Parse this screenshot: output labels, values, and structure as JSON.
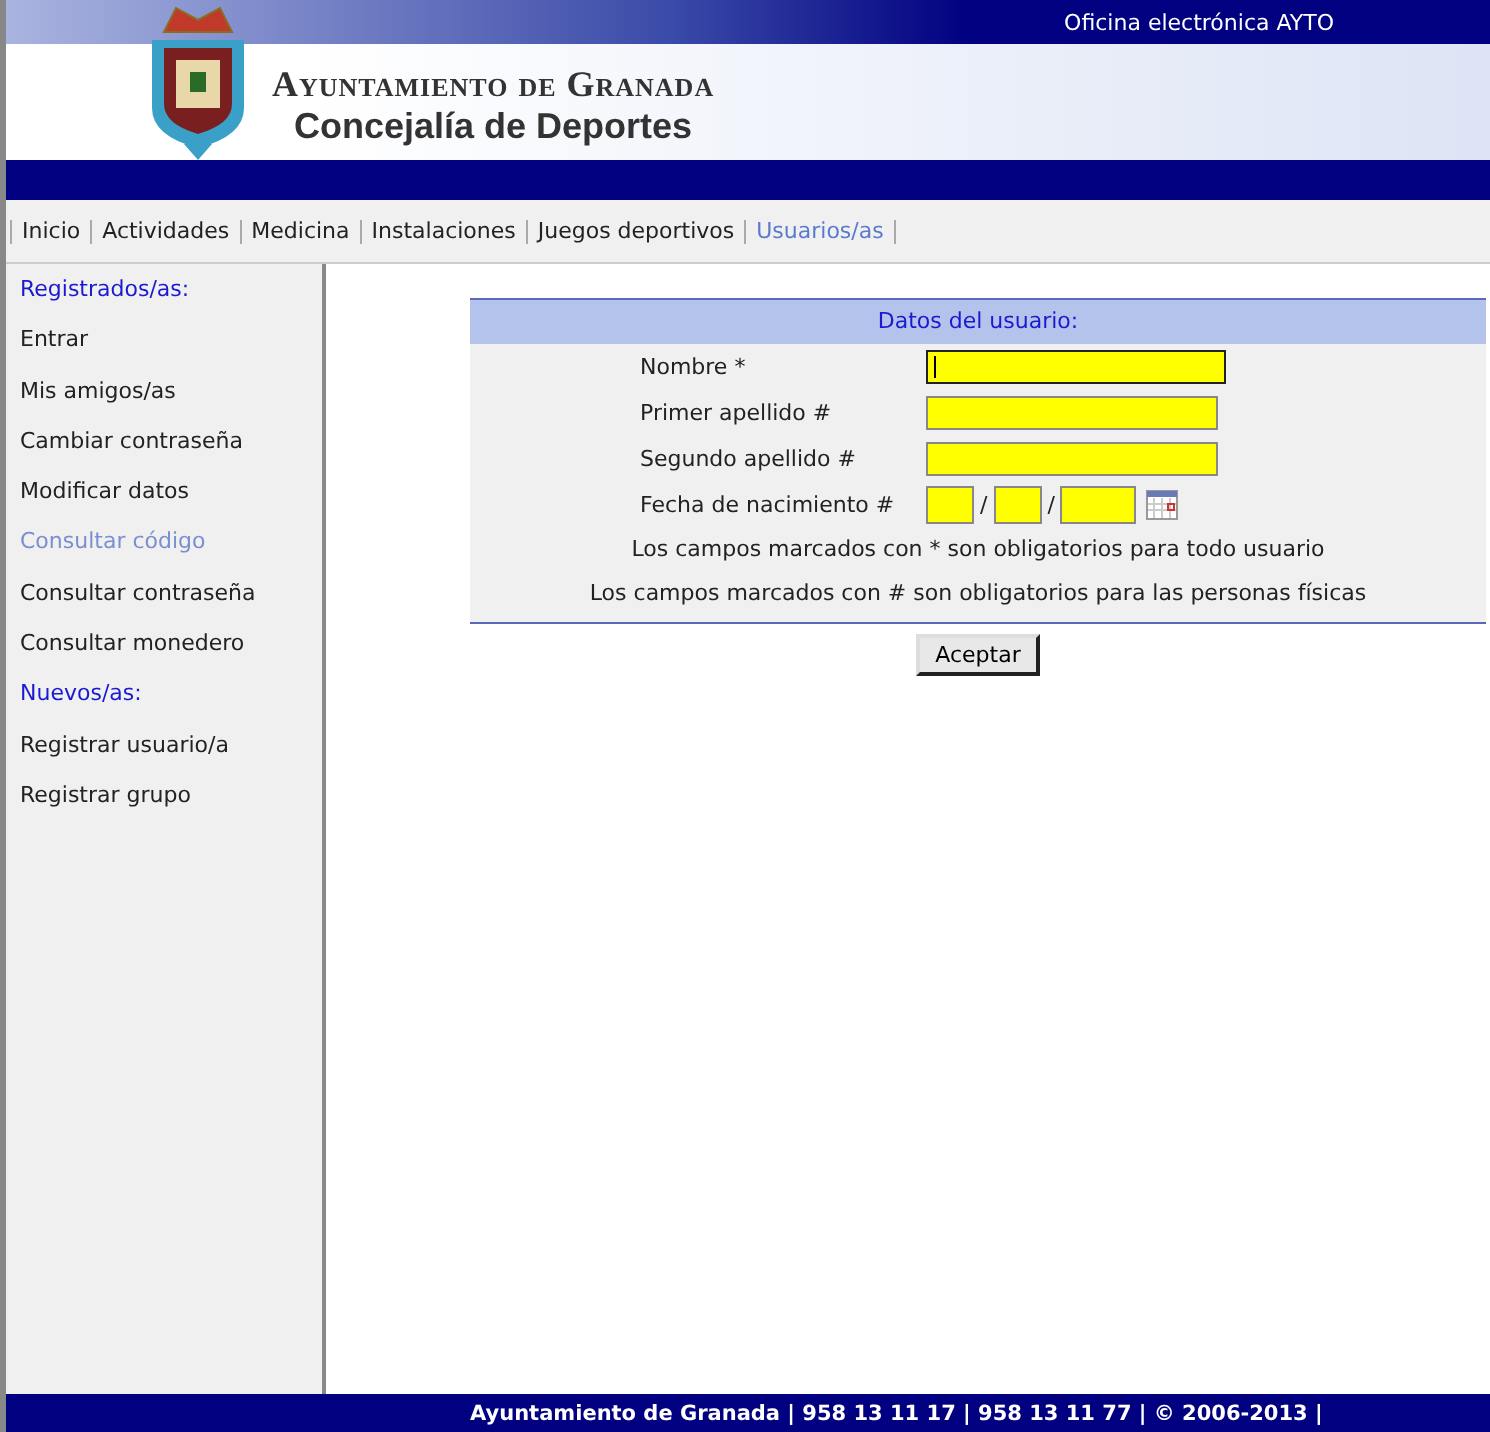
{
  "top_bar": {
    "title": "Oficina electrónica AYTO"
  },
  "header": {
    "title": "Ayuntamiento de Granada",
    "subtitle": "Concejalía de Deportes"
  },
  "nav": [
    {
      "label": "Inicio",
      "selected": false
    },
    {
      "label": "Actividades",
      "selected": false
    },
    {
      "label": "Medicina",
      "selected": false
    },
    {
      "label": "Instalaciones",
      "selected": false
    },
    {
      "label": "Juegos deportivos",
      "selected": false
    },
    {
      "label": "Usuarios/as",
      "selected": true
    }
  ],
  "sidebar": [
    {
      "kind": "heading",
      "label": "Registrados/as:",
      "selected": false
    },
    {
      "kind": "link",
      "label": "Entrar",
      "selected": false
    },
    {
      "kind": "link",
      "label": "Mis amigos/as",
      "selected": false
    },
    {
      "kind": "link",
      "label": "Cambiar contraseña",
      "selected": false
    },
    {
      "kind": "link",
      "label": "Modificar datos",
      "selected": false
    },
    {
      "kind": "link",
      "label": "Consultar código",
      "selected": true
    },
    {
      "kind": "link",
      "label": "Consultar contraseña",
      "selected": false
    },
    {
      "kind": "link",
      "label": "Consultar monedero",
      "selected": false
    },
    {
      "kind": "heading",
      "label": "Nuevos/as:",
      "selected": false
    },
    {
      "kind": "link",
      "label": "Registrar usuario/a",
      "selected": false
    },
    {
      "kind": "link",
      "label": "Registrar grupo",
      "selected": false
    }
  ],
  "form": {
    "title": "Datos del usuario:",
    "fields": [
      {
        "kind": "text",
        "label": "Nombre *",
        "focused": true
      },
      {
        "kind": "text",
        "label": "Primer apellido #",
        "focused": false
      },
      {
        "kind": "text",
        "label": "Segundo apellido #",
        "focused": false
      },
      {
        "kind": "date",
        "label": "Fecha de nacimiento #",
        "separators": [
          "/",
          "/"
        ],
        "focused": false
      }
    ],
    "notes": [
      "Los campos marcados con * son obligatorios para todo usuario",
      "Los campos marcados con # son obligatorios para las personas físicas"
    ],
    "submit": "Aceptar"
  },
  "footer": "Ayuntamiento de Granada | 958 13 11 17 | 958 13 11 77 | © 2006-2013 |"
}
